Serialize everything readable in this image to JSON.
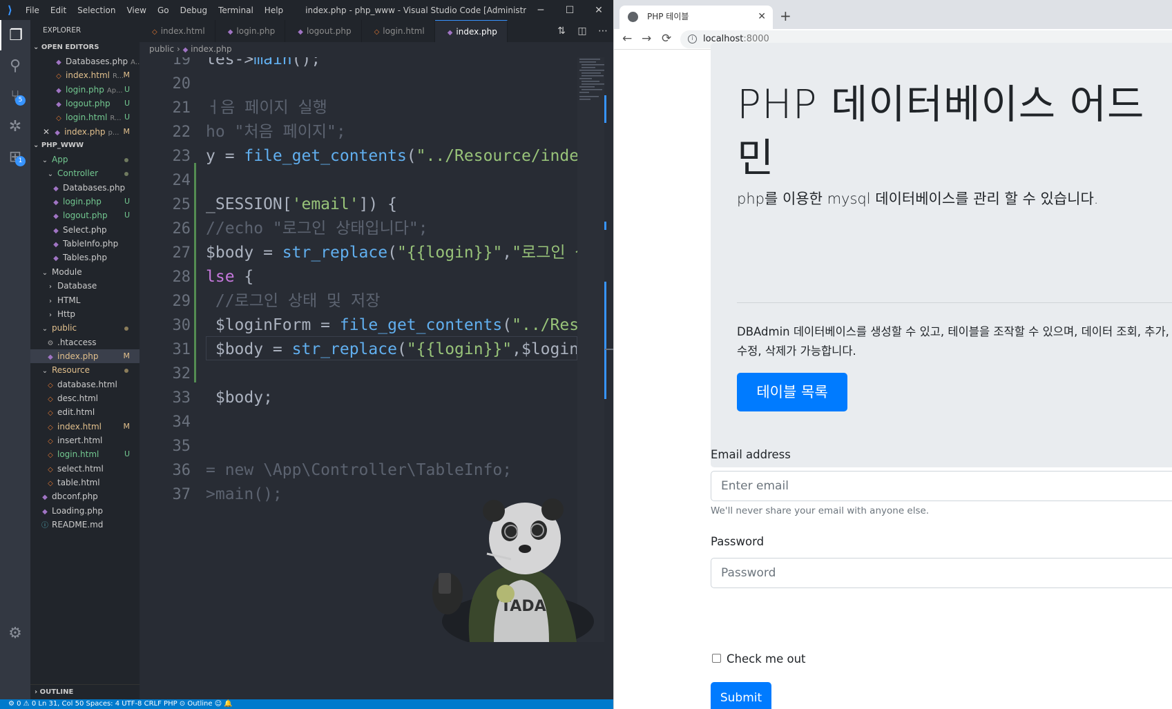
{
  "vscode": {
    "title": "index.php - php_www - Visual Studio Code [Administrator] [Unsuppor...",
    "menu": [
      "File",
      "Edit",
      "Selection",
      "View",
      "Go",
      "Debug",
      "Terminal",
      "Help"
    ],
    "window_controls": [
      "─",
      "☐",
      "✕"
    ],
    "activity_badges": {
      "scm": "5",
      "extensions": "1"
    },
    "explorer_title": "EXPLORER",
    "open_editors_title": "OPEN EDITORS",
    "open_editors": [
      {
        "name": "Databases.php",
        "extra": "A...",
        "type": "php",
        "status": "",
        "close": ""
      },
      {
        "name": "index.html",
        "extra": "R...",
        "type": "html",
        "status": "M",
        "close": ""
      },
      {
        "name": "login.php",
        "extra": "Ap...",
        "type": "php",
        "status": "U",
        "close": ""
      },
      {
        "name": "logout.php",
        "extra": "",
        "type": "php",
        "status": "U",
        "close": ""
      },
      {
        "name": "login.html",
        "extra": "R...",
        "type": "html",
        "status": "U",
        "close": ""
      },
      {
        "name": "index.php",
        "extra": "p...",
        "type": "php",
        "status": "M",
        "close": "✕"
      }
    ],
    "project_title": "PHP_WWW",
    "tree": [
      {
        "name": "App",
        "kind": "folder-open",
        "indent": 1,
        "dot": "g"
      },
      {
        "name": "Controller",
        "kind": "folder-open",
        "indent": 2,
        "dot": "g"
      },
      {
        "name": "Databases.php",
        "kind": "php",
        "indent": 3,
        "status": ""
      },
      {
        "name": "login.php",
        "kind": "php",
        "indent": 3,
        "status": "U"
      },
      {
        "name": "logout.php",
        "kind": "php",
        "indent": 3,
        "status": "U"
      },
      {
        "name": "Select.php",
        "kind": "php",
        "indent": 3,
        "status": ""
      },
      {
        "name": "TableInfo.php",
        "kind": "php",
        "indent": 3,
        "status": ""
      },
      {
        "name": "Tables.php",
        "kind": "php",
        "indent": 3,
        "status": ""
      },
      {
        "name": "Module",
        "kind": "folder-open",
        "indent": 1,
        "dot": ""
      },
      {
        "name": "Database",
        "kind": "folder",
        "indent": 2,
        "dot": ""
      },
      {
        "name": "HTML",
        "kind": "folder",
        "indent": 2,
        "dot": ""
      },
      {
        "name": "Http",
        "kind": "folder",
        "indent": 2,
        "dot": ""
      },
      {
        "name": "public",
        "kind": "folder-open",
        "indent": 1,
        "dot": "p"
      },
      {
        "name": ".htaccess",
        "kind": "gear",
        "indent": 2,
        "status": ""
      },
      {
        "name": "index.php",
        "kind": "php",
        "indent": 2,
        "status": "M",
        "selected": true
      },
      {
        "name": "Resource",
        "kind": "folder-open",
        "indent": 1,
        "dot": "p"
      },
      {
        "name": "database.html",
        "kind": "html",
        "indent": 2,
        "status": ""
      },
      {
        "name": "desc.html",
        "kind": "html",
        "indent": 2,
        "status": ""
      },
      {
        "name": "edit.html",
        "kind": "html",
        "indent": 2,
        "status": ""
      },
      {
        "name": "index.html",
        "kind": "html",
        "indent": 2,
        "status": "M"
      },
      {
        "name": "insert.html",
        "kind": "html",
        "indent": 2,
        "status": ""
      },
      {
        "name": "login.html",
        "kind": "html",
        "indent": 2,
        "status": "U"
      },
      {
        "name": "select.html",
        "kind": "html",
        "indent": 2,
        "status": ""
      },
      {
        "name": "table.html",
        "kind": "html",
        "indent": 2,
        "status": ""
      },
      {
        "name": "dbconf.php",
        "kind": "php",
        "indent": 1,
        "status": ""
      },
      {
        "name": "Loading.php",
        "kind": "php",
        "indent": 1,
        "status": ""
      },
      {
        "name": "README.md",
        "kind": "info",
        "indent": 1,
        "status": ""
      }
    ],
    "outline_title": "OUTLINE",
    "tabs": [
      {
        "name": "index.html",
        "type": "html",
        "active": false
      },
      {
        "name": "login.php",
        "type": "php",
        "active": false
      },
      {
        "name": "logout.php",
        "type": "php",
        "active": false
      },
      {
        "name": "login.html",
        "type": "html",
        "active": false
      },
      {
        "name": "index.php",
        "type": "php",
        "active": true
      }
    ],
    "tab_actions": [
      "⇅",
      "◫",
      "⋯"
    ],
    "breadcrumb": {
      "folder": "public",
      "sep": "›",
      "file": "index.php"
    },
    "code_lines": [
      {
        "n": "19",
        "segs": [
          [
            "p",
            "les->"
          ],
          [
            "f",
            "main"
          ],
          [
            "p",
            "();"
          ]
        ]
      },
      {
        "n": "20",
        "segs": []
      },
      {
        "n": "21",
        "segs": [
          [
            "cm",
            "ㅓ음 페이지 실행"
          ]
        ]
      },
      {
        "n": "22",
        "segs": [
          [
            "cm",
            "ho \"처음 페이지\";"
          ]
        ]
      },
      {
        "n": "23",
        "segs": [
          [
            "p",
            "y = "
          ],
          [
            "f",
            "file_get_contents"
          ],
          [
            "p",
            "("
          ],
          [
            "s",
            "\"../Resource/index.h"
          ]
        ]
      },
      {
        "n": "24",
        "segs": []
      },
      {
        "n": "25",
        "segs": [
          [
            "p",
            "_SESSION["
          ],
          [
            "s",
            "'email'"
          ],
          [
            "p",
            "]) {"
          ]
        ]
      },
      {
        "n": "26",
        "segs": [
          [
            "cm",
            "//echo \"로그인 상태입니다\";"
          ]
        ]
      },
      {
        "n": "27",
        "segs": [
          [
            "p",
            "$body = "
          ],
          [
            "f",
            "str_replace"
          ],
          [
            "p",
            "("
          ],
          [
            "s",
            "\"{{login}}\""
          ],
          [
            "p",
            ","
          ],
          [
            "s",
            "\"로그인 상"
          ]
        ]
      },
      {
        "n": "28",
        "segs": [
          [
            "k",
            "lse"
          ],
          [
            "p",
            " {"
          ]
        ]
      },
      {
        "n": "29",
        "segs": [
          [
            "cm",
            " //로그인 상태 및 저장"
          ]
        ]
      },
      {
        "n": "30",
        "segs": [
          [
            "p",
            " $loginForm = "
          ],
          [
            "f",
            "file_get_contents"
          ],
          [
            "p",
            "("
          ],
          [
            "s",
            "\"../Resour"
          ]
        ]
      },
      {
        "n": "31",
        "segs": [
          [
            "p",
            " $body = "
          ],
          [
            "f",
            "str_replace"
          ],
          [
            "p",
            "("
          ],
          [
            "s",
            "\"{{login}}\""
          ],
          [
            "p",
            ",$loginFor"
          ]
        ]
      },
      {
        "n": "32",
        "segs": []
      },
      {
        "n": "33",
        "segs": [
          [
            "p",
            " $body;"
          ]
        ]
      },
      {
        "n": "34",
        "segs": []
      },
      {
        "n": "35",
        "segs": []
      },
      {
        "n": "36",
        "segs": [
          [
            "cm",
            "= new \\App\\Controller\\TableInfo;"
          ]
        ]
      },
      {
        "n": "37",
        "segs": [
          [
            "cm",
            ">main();"
          ]
        ]
      }
    ],
    "status_text": "⚙ 0 ⚠ 0                                    Ln 31, Col 50   Spaces: 4   UTF-8   CRLF   PHP   ⊙ Outline   ☺   🔔"
  },
  "browser": {
    "tab_title": "PHP 테이블",
    "tab_close": "✕",
    "new_tab": "+",
    "nav": [
      "←",
      "→",
      "⟳"
    ],
    "url_host": "localhost",
    "url_port": ":8000",
    "jumbotron": {
      "title": "PHP 데이터베이스 어드민",
      "lead": "php를 이용한 mysql 데이터베이스를 관리 할 수 있습니다.",
      "desc": "DBAdmin 데이터베이스를 생성할 수 있고, 테이블을 조작할 수 있으며, 데이터 조회, 추가, 수정, 삭제가 가능합니다.",
      "button": "테이블 목록"
    },
    "form": {
      "email_label": "Email address",
      "email_placeholder": "Enter email",
      "email_help": "We'll never share your email with anyone else.",
      "password_label": "Password",
      "password_placeholder": "Password",
      "check_label": "Check me out",
      "submit": "Submit"
    }
  },
  "colors": {
    "accent": "#007bff",
    "vscode_blue": "#007acc",
    "bg_editor": "#282c34"
  }
}
